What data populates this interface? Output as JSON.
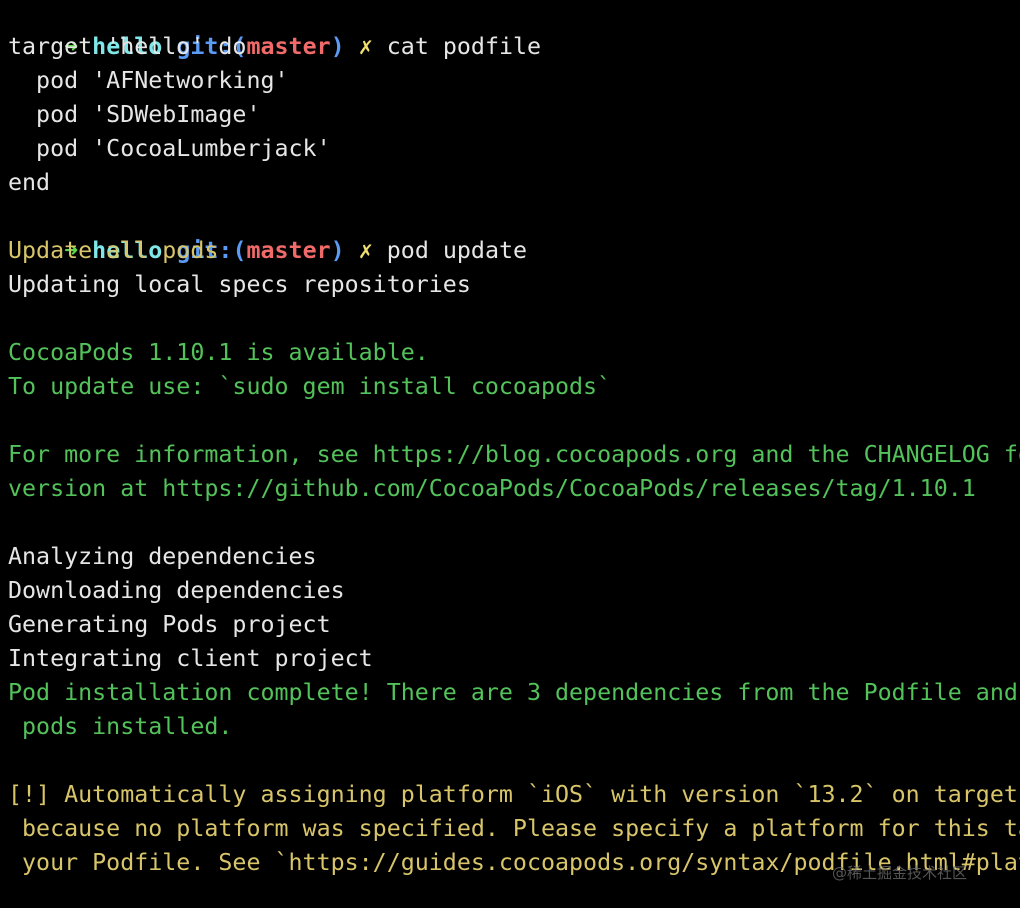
{
  "prompt": {
    "arrow": "➜",
    "dir": "hello",
    "git_open": "git:(",
    "branch": "master",
    "git_close": ")",
    "dirty": "✗"
  },
  "commands": {
    "cat": "cat podfile",
    "update": "pod update"
  },
  "podfile": {
    "line1": "target 'hello' do",
    "line2": "  pod 'AFNetworking'",
    "line3": "  pod 'SDWebImage'",
    "line4": "  pod 'CocoaLumberjack'",
    "line5": "end"
  },
  "output": {
    "update_all": "Update all pods",
    "updating_specs": "Updating local specs repositories",
    "available": "CocoaPods 1.10.1 is available.",
    "to_update": "To update use: `sudo gem install cocoapods`",
    "more_info": "For more information, see https://blog.cocoapods.org and the CHANGELOG fo",
    "version_at": "version at https://github.com/CocoaPods/CocoaPods/releases/tag/1.10.1",
    "analyzing": "Analyzing dependencies",
    "downloading": "Downloading dependencies",
    "generating": "Generating Pods project",
    "integrating": "Integrating client project",
    "complete1": "Pod installation complete! There are 3 dependencies from the Podfile and",
    "complete2": " pods installed.",
    "warn1": "[!] Automatically assigning platform `iOS` with version `13.2` on target",
    "warn2": " because no platform was specified. Please specify a platform for this ta",
    "warn3": " your Podfile. See `https://guides.cocoapods.org/syntax/podfile.html#plat"
  },
  "watermark": "@稀土掘金技术社区",
  "colors": {
    "background": "#000000",
    "prompt_arrow": "#5fd74c",
    "prompt_dir": "#7fe7e7",
    "prompt_git": "#5b9bf5",
    "prompt_branch": "#f06a6a",
    "prompt_dirty": "#f0e070",
    "info_yellow": "#d8c56a",
    "info_green": "#53c25a",
    "text": "#e6e6e6"
  }
}
